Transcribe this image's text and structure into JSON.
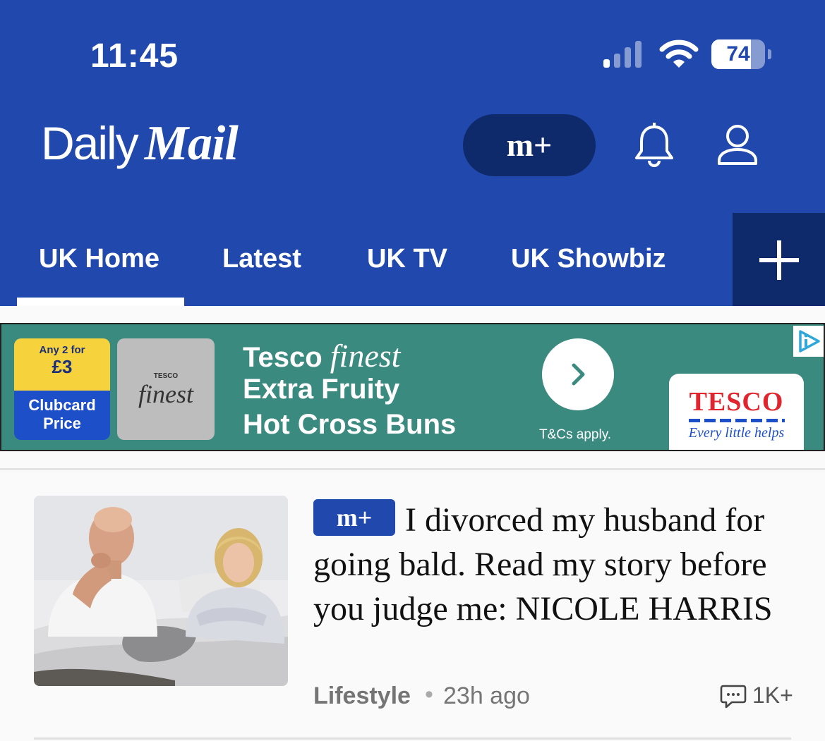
{
  "status_bar": {
    "time": "11:45",
    "battery_level": "74",
    "icons": [
      "cellular-signal-icon",
      "wifi-icon",
      "battery-icon"
    ]
  },
  "header": {
    "logo_daily": "Daily",
    "logo_mail": "Mail",
    "mplus_label": "m+",
    "icons": [
      "bell-icon",
      "user-icon"
    ]
  },
  "nav": {
    "tabs": [
      {
        "label": "UK Home",
        "active": true
      },
      {
        "label": "Latest"
      },
      {
        "label": "UK TV"
      },
      {
        "label": "UK Showbiz"
      }
    ],
    "more_icon": "plus-icon"
  },
  "ad": {
    "tag_small": "Any 2 for",
    "tag_price": "£3",
    "tag_bottom_1": "Clubcard",
    "tag_bottom_2": "Price",
    "product_brand": "TESCO",
    "product_word": "finest",
    "headline_brand": "Tesco",
    "headline_finest": "finest",
    "headline_line2": "Extra Fruity",
    "headline_line3": "Hot Cross Buns",
    "terms": "T&Cs apply.",
    "logo_word": "TESCO",
    "logo_slogan": "Every little helps",
    "icons": [
      "chevron-right-icon",
      "ad-choices-icon"
    ]
  },
  "article": {
    "badge": "m+",
    "headline": "I divorced my husband for going bald. Read my story before you judge me: NICOLE HARRIS",
    "category": "Lifestyle",
    "separator": "•",
    "time_ago": "23h ago",
    "comment_count": "1K+",
    "icons": [
      "comment-icon"
    ]
  },
  "colors": {
    "brand_blue": "#2149ad",
    "dark_blue": "#0e2a6b",
    "ad_teal": "#3b8a80",
    "tesco_red": "#e0252e"
  }
}
